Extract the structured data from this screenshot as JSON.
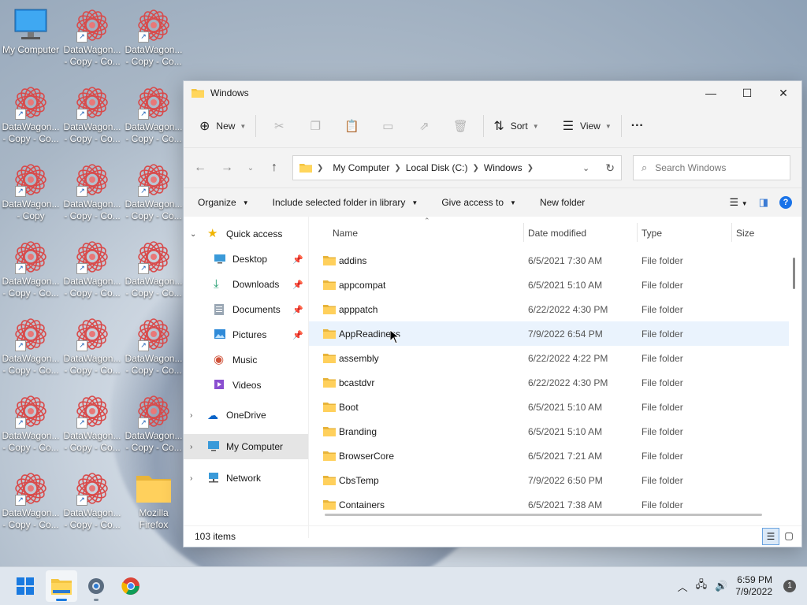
{
  "desktop": {
    "icons": [
      {
        "label": "My Computer",
        "type": "computer"
      },
      {
        "label": "DataWagon...\n- Copy - Co...",
        "type": "rose"
      },
      {
        "label": "DataWagon...\n- Copy - Co...",
        "type": "rose"
      },
      {
        "label": "DataWagon...\n- Copy - Co...",
        "type": "rose"
      },
      {
        "label": "DataWagon...\n- Copy - Co...",
        "type": "rose"
      },
      {
        "label": "DataWagon...\n- Copy - Co...",
        "type": "rose"
      },
      {
        "label": "DataWagon...\n- Copy",
        "type": "rose"
      },
      {
        "label": "DataWagon...\n- Copy - Co...",
        "type": "rose"
      },
      {
        "label": "DataWagon...\n- Copy - Co...",
        "type": "rose"
      },
      {
        "label": "DataWagon...\n- Copy - Co...",
        "type": "rose"
      },
      {
        "label": "DataWagon...\n- Copy - Co...",
        "type": "rose"
      },
      {
        "label": "DataWagon...\n- Copy - Co...",
        "type": "rose"
      },
      {
        "label": "DataWagon...\n- Copy - Co...",
        "type": "rose"
      },
      {
        "label": "DataWagon...\n- Copy - Co...",
        "type": "rose"
      },
      {
        "label": "DataWagon...\n- Copy - Co...",
        "type": "rose"
      },
      {
        "label": "DataWagon...\n- Copy - Co...",
        "type": "rose"
      },
      {
        "label": "DataWagon...\n- Copy - Co...",
        "type": "rose"
      },
      {
        "label": "DataWagon...\n- Copy - Co...",
        "type": "rose"
      },
      {
        "label": "DataWagon...\n- Copy - Co...",
        "type": "rose"
      },
      {
        "label": "DataWagon...\n- Copy - Co...",
        "type": "rose"
      },
      {
        "label": "Mozilla\nFirefox",
        "type": "folder"
      }
    ]
  },
  "window": {
    "title": "Windows",
    "controls": {
      "minimize": "—",
      "maximize": "☐",
      "close": "✕"
    },
    "command_bar": {
      "new_label": "New",
      "sort_label": "Sort",
      "view_label": "View",
      "more_label": "···"
    },
    "address": {
      "crumbs": [
        "My Computer",
        "Local Disk (C:)",
        "Windows"
      ],
      "search_placeholder": "Search Windows"
    },
    "ribbon": {
      "organize": "Organize",
      "include": "Include selected folder in library",
      "give_access": "Give access to",
      "new_folder": "New folder",
      "help": "?"
    },
    "nav_pane": {
      "quick_access": "Quick access",
      "desktop": "Desktop",
      "downloads": "Downloads",
      "documents": "Documents",
      "pictures": "Pictures",
      "music": "Music",
      "videos": "Videos",
      "onedrive": "OneDrive",
      "my_computer": "My Computer",
      "network": "Network"
    },
    "columns": {
      "name": "Name",
      "date": "Date modified",
      "type": "Type",
      "size": "Size"
    },
    "files": [
      {
        "name": "addins",
        "date": "6/5/2021 7:30 AM",
        "type": "File folder"
      },
      {
        "name": "appcompat",
        "date": "6/5/2021 5:10 AM",
        "type": "File folder"
      },
      {
        "name": "apppatch",
        "date": "6/22/2022 4:30 PM",
        "type": "File folder"
      },
      {
        "name": "AppReadiness",
        "date": "7/9/2022 6:54 PM",
        "type": "File folder"
      },
      {
        "name": "assembly",
        "date": "6/22/2022 4:22 PM",
        "type": "File folder"
      },
      {
        "name": "bcastdvr",
        "date": "6/22/2022 4:30 PM",
        "type": "File folder"
      },
      {
        "name": "Boot",
        "date": "6/5/2021 5:10 AM",
        "type": "File folder"
      },
      {
        "name": "Branding",
        "date": "6/5/2021 5:10 AM",
        "type": "File folder"
      },
      {
        "name": "BrowserCore",
        "date": "6/5/2021 7:21 AM",
        "type": "File folder"
      },
      {
        "name": "CbsTemp",
        "date": "7/9/2022 6:50 PM",
        "type": "File folder"
      },
      {
        "name": "Containers",
        "date": "6/5/2021 7:38 AM",
        "type": "File folder"
      }
    ],
    "status": {
      "items": "103 items"
    }
  },
  "taskbar": {
    "time": "6:59 PM",
    "date": "7/9/2022",
    "notifications": "1"
  }
}
